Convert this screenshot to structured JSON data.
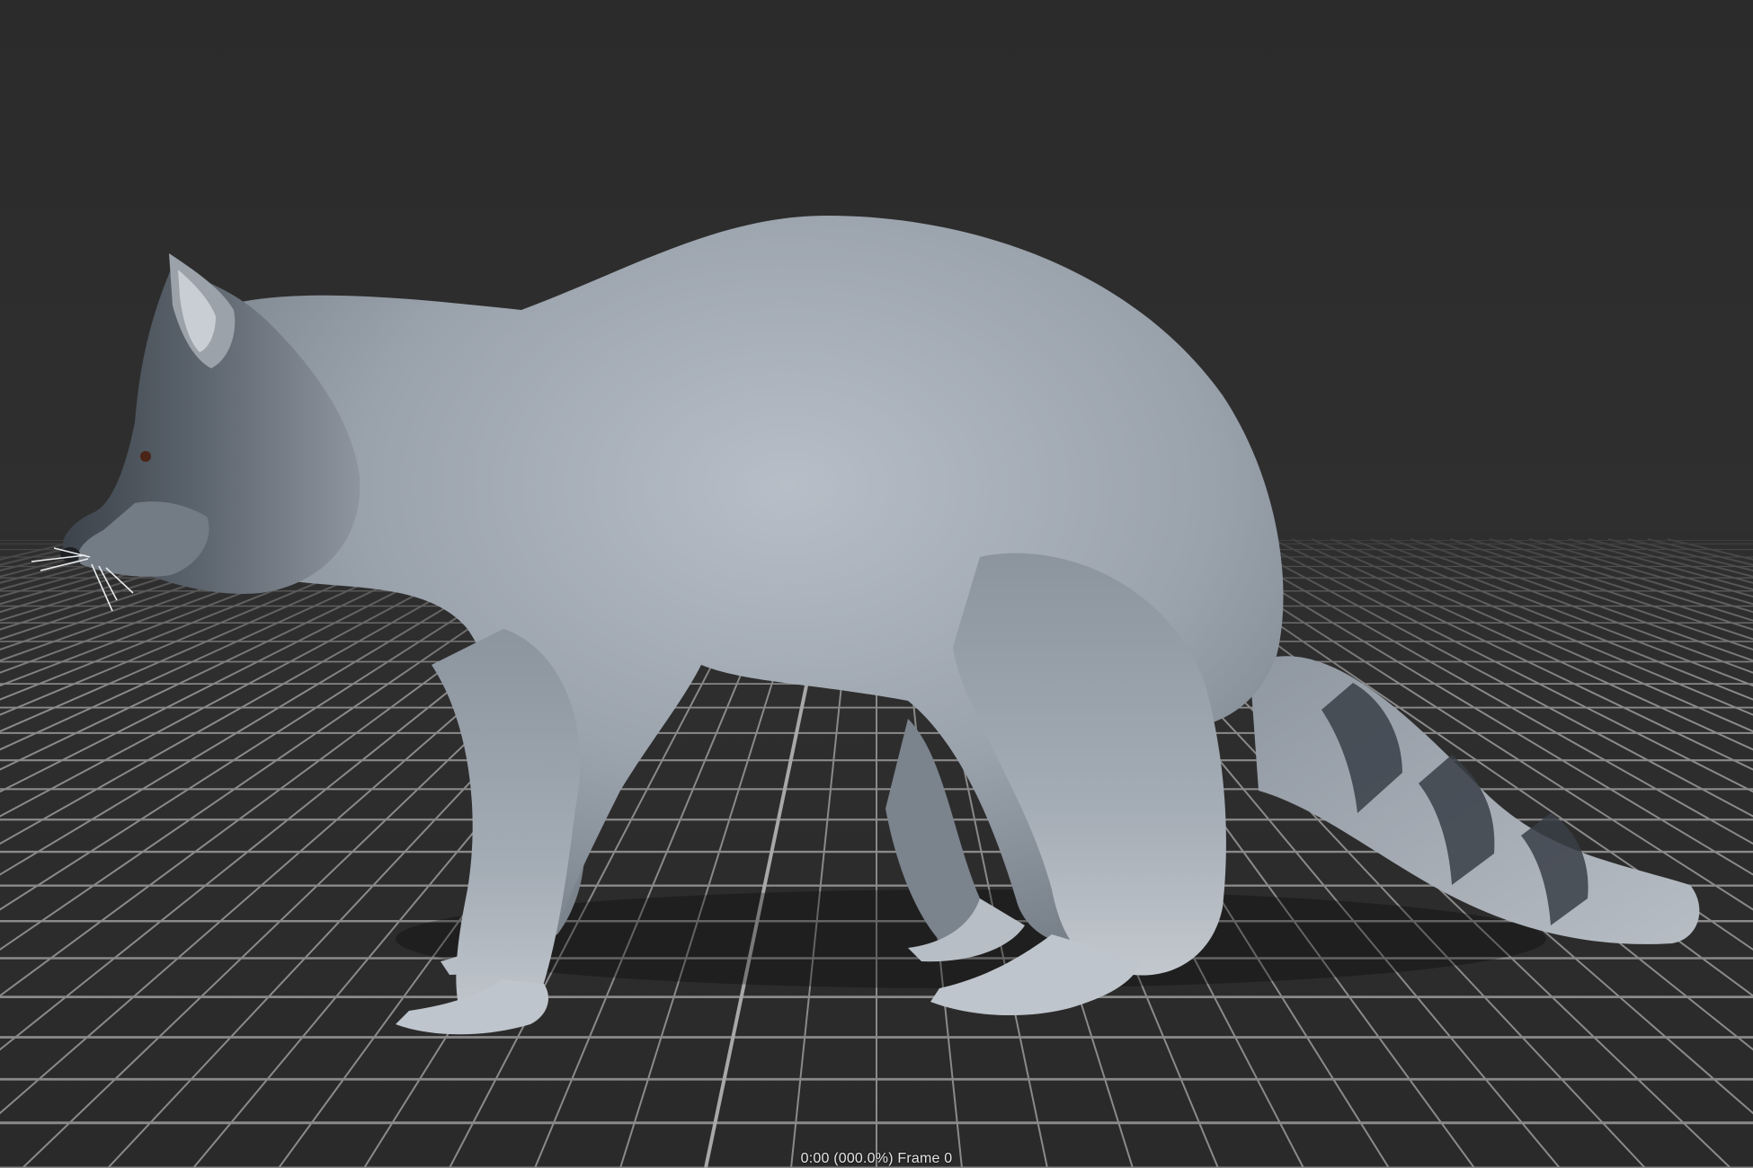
{
  "viewport": {
    "background_color": "#2e2e2e",
    "grid_color": "#8a8a8a",
    "grid_axis_color": "#a8a8a8",
    "subject": "raccoon-3d-model"
  },
  "status": {
    "frame_readout": "0:00 (000.0%) Frame 0"
  },
  "playback": {
    "time": "0:00",
    "percent": "000.0%",
    "frame": 0
  }
}
